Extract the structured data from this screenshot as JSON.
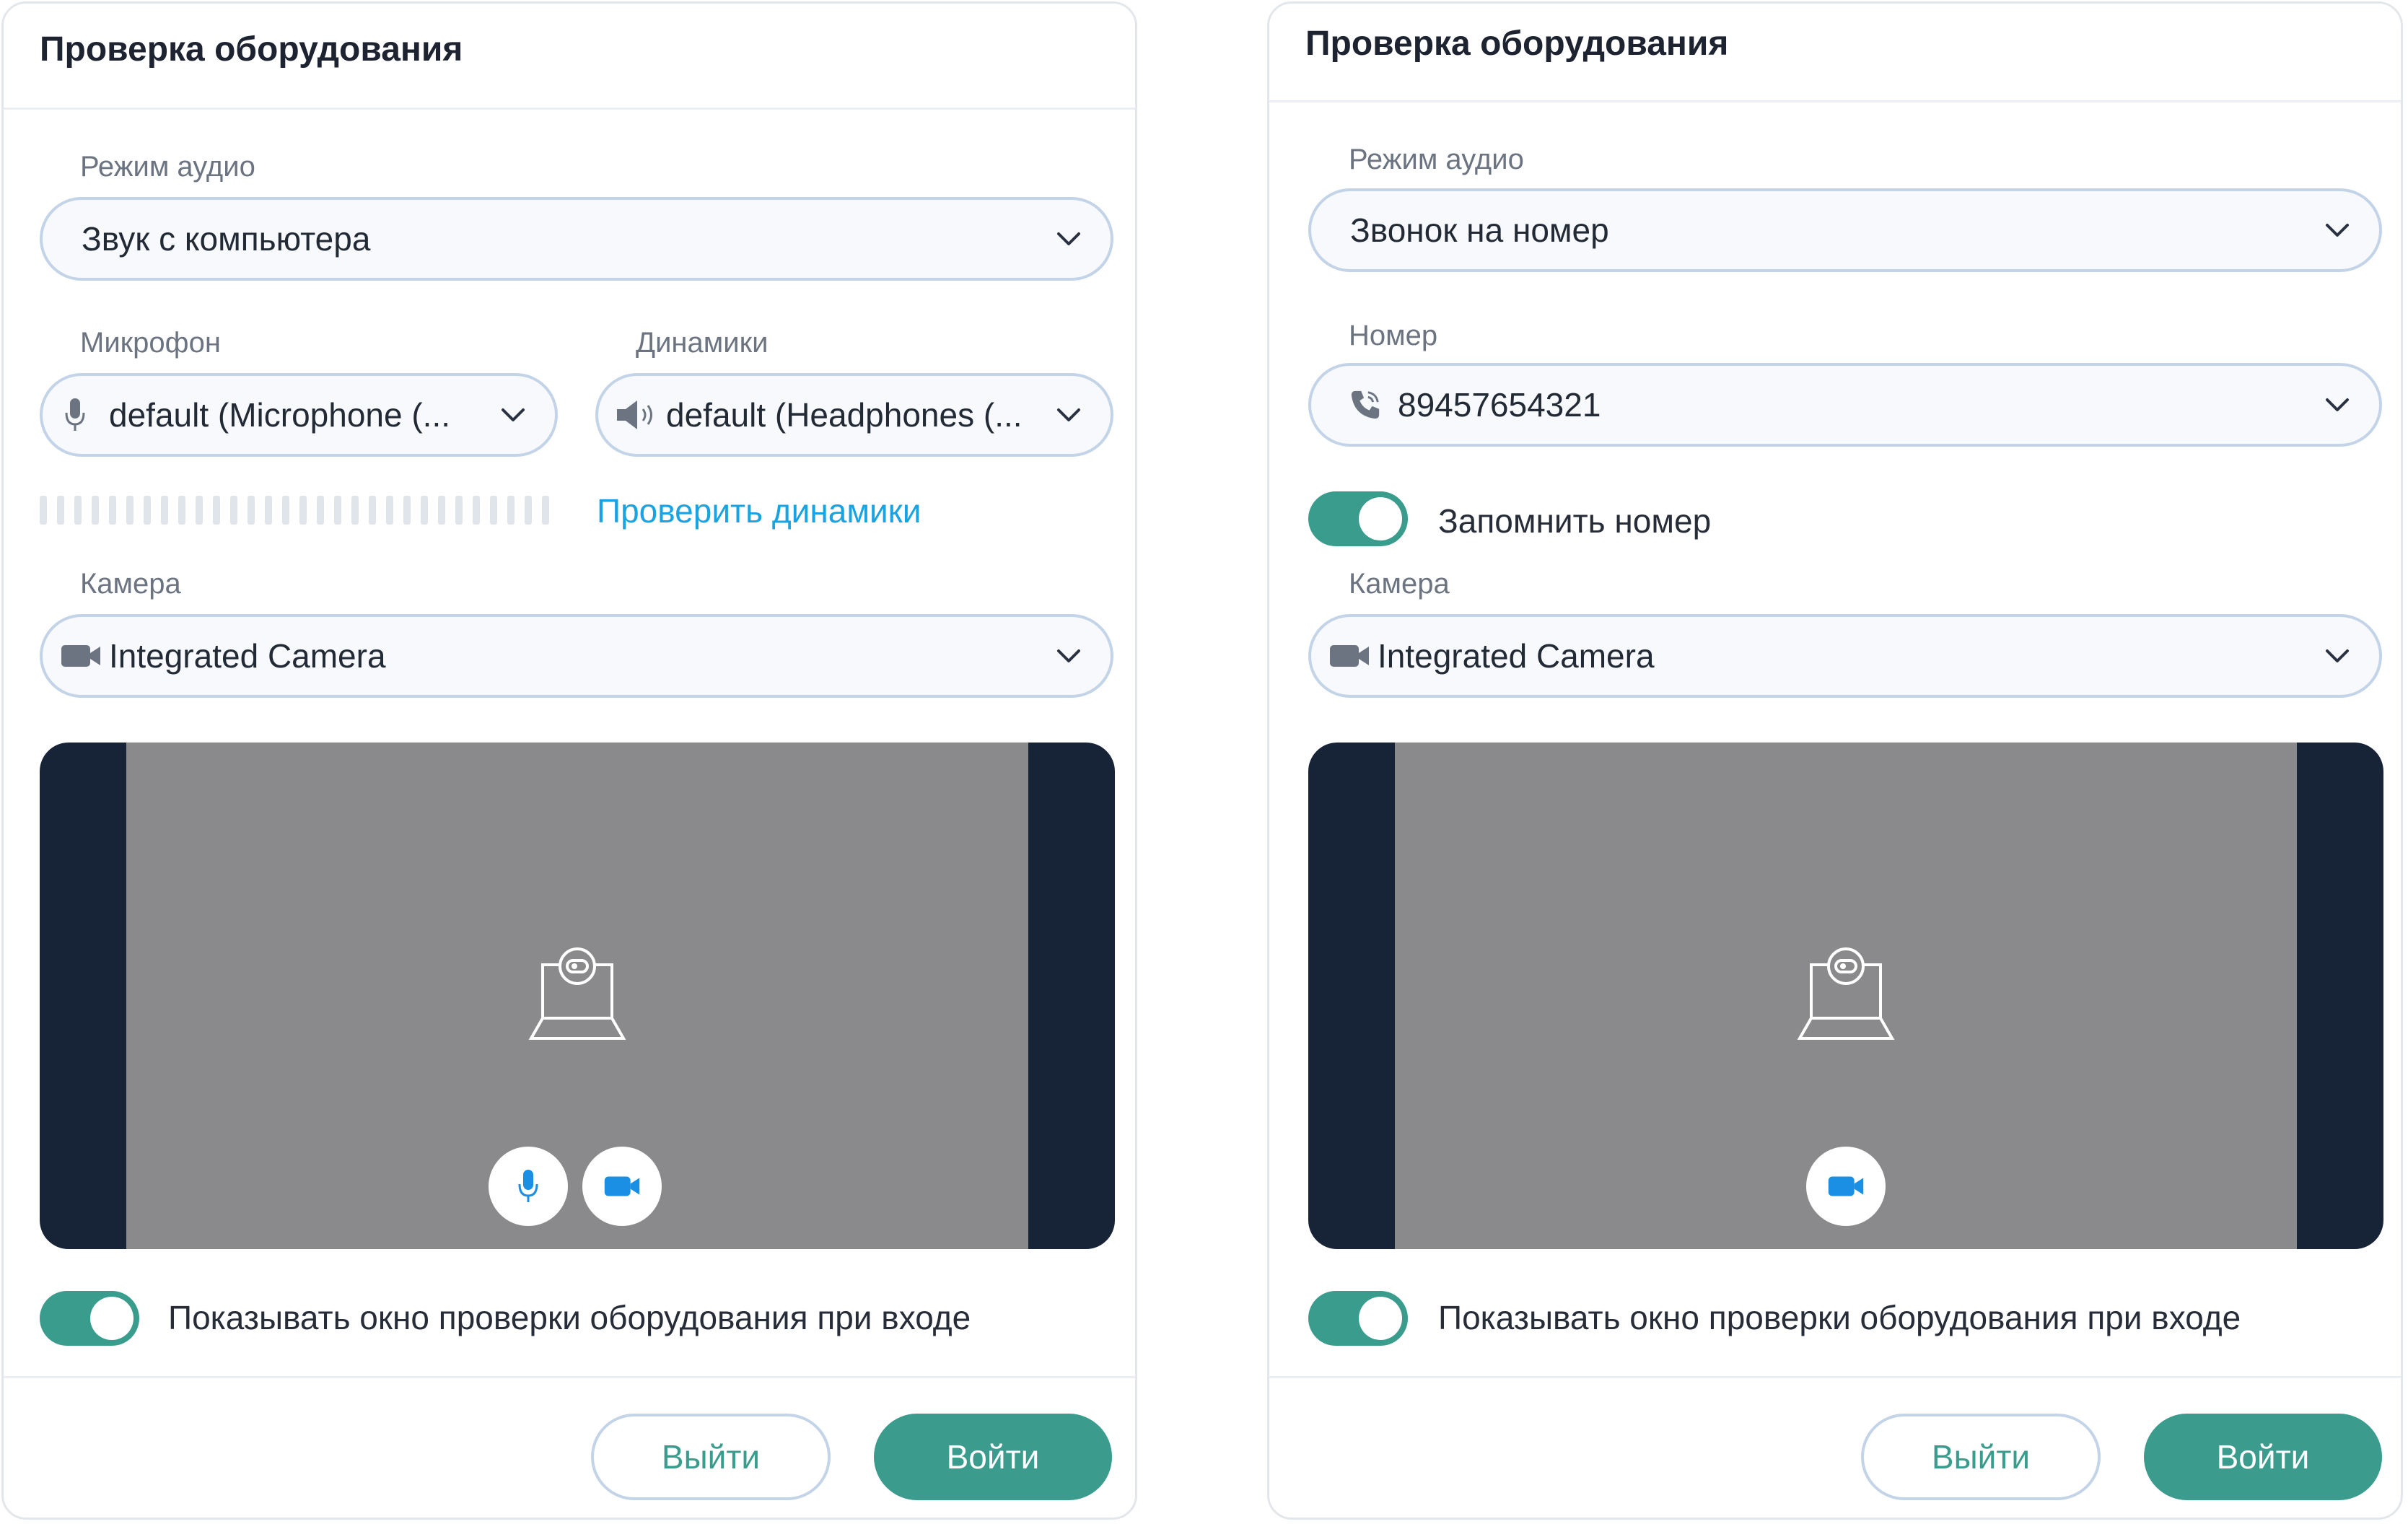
{
  "colors": {
    "accent": "#3b9c8d",
    "link": "#1aa3e3",
    "border": "#c4d4e8",
    "preview_bg": "#172337",
    "preview_stage": "#8a8a8c"
  },
  "left": {
    "title": "Проверка оборудования",
    "audio_mode_label": "Режим аудио",
    "audio_mode_value": "Звук с компьютера",
    "mic_label": "Микрофон",
    "mic_value": "default (Microphone (...",
    "speakers_label": "Динамики",
    "speakers_value": "default (Headphones (...",
    "check_speakers_link": "Проверить динамики",
    "camera_label": "Камера",
    "camera_value": "Integrated Camera",
    "show_on_join_label": "Показывать окно проверки оборудования при входе",
    "show_on_join_on": true,
    "exit_label": "Выйти",
    "enter_label": "Войти",
    "icons": [
      "chevron-down-icon",
      "microphone-icon",
      "speaker-icon",
      "camera-icon",
      "webcam-placeholder-icon",
      "video-icon"
    ]
  },
  "right": {
    "title": "Проверка оборудования",
    "audio_mode_label": "Режим аудио",
    "audio_mode_value": "Звонок на номер",
    "number_label": "Номер",
    "number_value": "89457654321",
    "remember_number_label": "Запомнить номер",
    "remember_number_on": true,
    "camera_label": "Камера",
    "camera_value": "Integrated Camera",
    "show_on_join_label": "Показывать окно проверки оборудования при входе",
    "show_on_join_on": true,
    "exit_label": "Выйти",
    "enter_label": "Войти",
    "icons": [
      "chevron-down-icon",
      "phone-icon",
      "camera-icon",
      "webcam-placeholder-icon",
      "video-icon"
    ]
  }
}
